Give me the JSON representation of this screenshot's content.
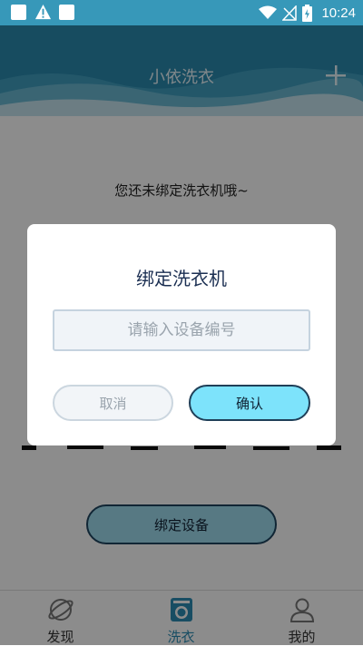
{
  "status_bar": {
    "time": "10:24"
  },
  "header": {
    "title": "小依洗衣"
  },
  "content": {
    "empty_message": "您还未绑定洗衣机哦~",
    "bind_button_label": "绑定设备"
  },
  "dialog": {
    "title": "绑定洗衣机",
    "input_placeholder": "请输入设备编号",
    "input_value": "",
    "cancel_label": "取消",
    "confirm_label": "确认"
  },
  "bottom_nav": {
    "items": [
      {
        "label": "发现",
        "icon": "planet-icon",
        "active": false
      },
      {
        "label": "洗衣",
        "icon": "washing-machine-icon",
        "active": true
      },
      {
        "label": "我的",
        "icon": "user-icon",
        "active": false
      }
    ]
  },
  "colors": {
    "header": "#2a8bb0",
    "accent": "#2d8db4",
    "confirm": "#7de3fb"
  }
}
